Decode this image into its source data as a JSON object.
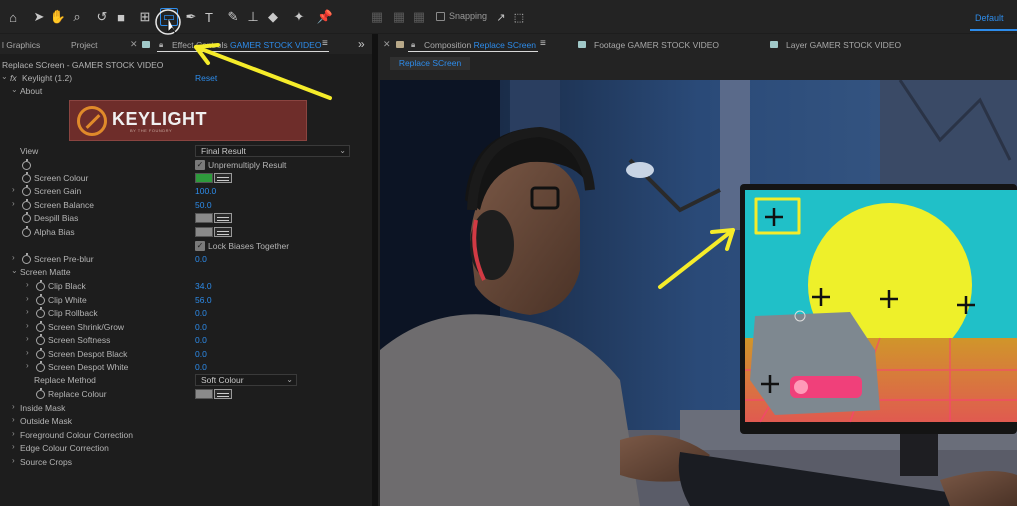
{
  "toolbar": {
    "snapping_label": "Snapping",
    "workspace_label": "Default",
    "icons": [
      "home-icon",
      "selection-arrow-icon",
      "hand-icon",
      "zoom-icon",
      "rotate-icon",
      "camera-icon",
      "pan-behind-icon",
      "mask-rectangle-icon",
      "pen-icon",
      "type-icon",
      "brush-icon",
      "clone-stamp-icon",
      "eraser-icon",
      "roto-brush-icon",
      "puppet-pin-icon"
    ]
  },
  "left_panel": {
    "tabs": {
      "graphics": "l Graphics",
      "project": "Project",
      "effect_controls_prefix": "Effect Controls",
      "effect_controls_layer": "GAMER STOCK VIDEO"
    },
    "breadcrumb": "Replace SCreen - GAMER STOCK VIDEO",
    "effect_name": "Keylight (1.2)",
    "reset_label": "Reset",
    "about_label": "About",
    "logo_text": "KEYLIGHT",
    "logo_sub": "BY THE FOUNDRY",
    "params": {
      "view_label": "View",
      "view_value": "Final Result",
      "unpremultiply_label": "Unpremultiply Result",
      "screen_colour_label": "Screen Colour",
      "screen_colour": "#2e9a3c",
      "screen_gain_label": "Screen Gain",
      "screen_gain": "100.0",
      "screen_balance_label": "Screen Balance",
      "screen_balance": "50.0",
      "despill_bias_label": "Despill Bias",
      "alpha_bias_label": "Alpha Bias",
      "bias_colour": "#8a8a8a",
      "lock_biases_label": "Lock Biases Together",
      "screen_preblur_label": "Screen Pre-blur",
      "screen_preblur": "0.0",
      "screen_matte_label": "Screen Matte",
      "clip_black_label": "Clip Black",
      "clip_black": "34.0",
      "clip_white_label": "Clip White",
      "clip_white": "56.0",
      "clip_rollback_label": "Clip Rollback",
      "clip_rollback": "0.0",
      "screen_shrink_label": "Screen Shrink/Grow",
      "screen_shrink": "0.0",
      "screen_softness_label": "Screen Softness",
      "screen_softness": "0.0",
      "despot_black_label": "Screen Despot Black",
      "despot_black": "0.0",
      "despot_white_label": "Screen Despot White",
      "despot_white": "0.0",
      "replace_method_label": "Replace Method",
      "replace_method": "Soft Colour",
      "replace_colour_label": "Replace Colour",
      "inside_mask_label": "Inside Mask",
      "outside_mask_label": "Outside Mask",
      "fg_correction_label": "Foreground Colour Correction",
      "edge_correction_label": "Edge Colour Correction",
      "source_crops_label": "Source Crops"
    }
  },
  "right_panel": {
    "tabs": {
      "composition_prefix": "Composition",
      "composition_name": "Replace SCreen",
      "footage": "Footage GAMER STOCK VIDEO",
      "layer": "Layer GAMER STOCK VIDEO"
    },
    "viewer_tab": "Replace SCreen"
  },
  "colors": {
    "accent": "#2d8ceb",
    "annotation": "#f5ec2a"
  }
}
